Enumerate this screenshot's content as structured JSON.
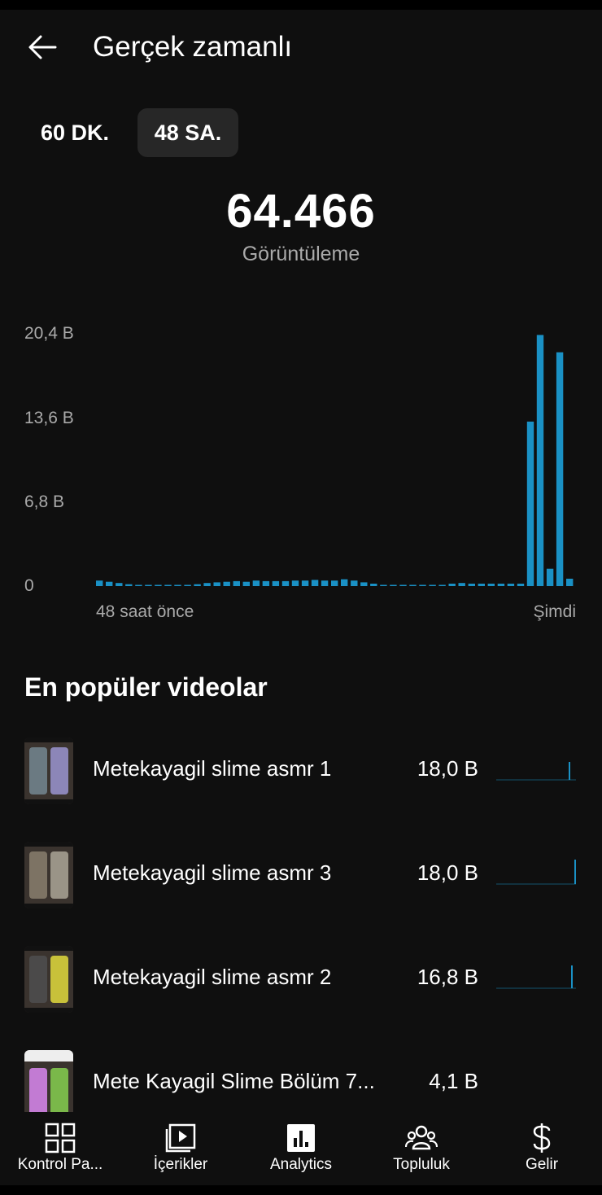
{
  "header": {
    "title": "Gerçek zamanlı",
    "back_icon": "arrow-left-icon"
  },
  "range_tabs": [
    {
      "label": "60 DK.",
      "selected": false
    },
    {
      "label": "48 SA.",
      "selected": true
    }
  ],
  "summary": {
    "value": "64.466",
    "label": "Görüntüleme"
  },
  "chart_data": {
    "type": "bar",
    "x_start_label": "48 saat önce",
    "x_end_label": "Şimdi",
    "y_tick_labels": [
      "20,4 B",
      "13,6 B",
      "6,8 B",
      "0"
    ],
    "ylim": [
      0,
      20400
    ],
    "y_ticks": [
      20400,
      13600,
      6800,
      0
    ],
    "grid": false,
    "color": "#1a91c5",
    "values": [
      450,
      350,
      250,
      150,
      50,
      0,
      0,
      0,
      50,
      100,
      150,
      250,
      300,
      350,
      400,
      350,
      450,
      400,
      400,
      400,
      450,
      450,
      500,
      450,
      450,
      550,
      450,
      300,
      200,
      100,
      50,
      0,
      0,
      0,
      50,
      100,
      200,
      250,
      200,
      200,
      200,
      200,
      200,
      200,
      13300,
      20300,
      1400,
      18900,
      600
    ]
  },
  "top_videos": {
    "title": "En popüler videolar",
    "items": [
      {
        "title": "Metekayagil slime asmr 1",
        "views": "18,0 B"
      },
      {
        "title": "Metekayagil slime asmr 3",
        "views": "18,0 B"
      },
      {
        "title": "Metekayagil slime asmr 2",
        "views": "16,8 B"
      },
      {
        "title": "Mete Kayagil Slime Bölüm 7...",
        "views": "4,1 B"
      }
    ]
  },
  "bottom_nav": [
    {
      "label": "Kontrol Pa...",
      "icon": "dashboard-icon"
    },
    {
      "label": "İçerikler",
      "icon": "content-icon"
    },
    {
      "label": "Analytics",
      "icon": "analytics-icon",
      "active": true
    },
    {
      "label": "Topluluk",
      "icon": "community-icon"
    },
    {
      "label": "Gelir",
      "icon": "dollar-icon"
    }
  ]
}
